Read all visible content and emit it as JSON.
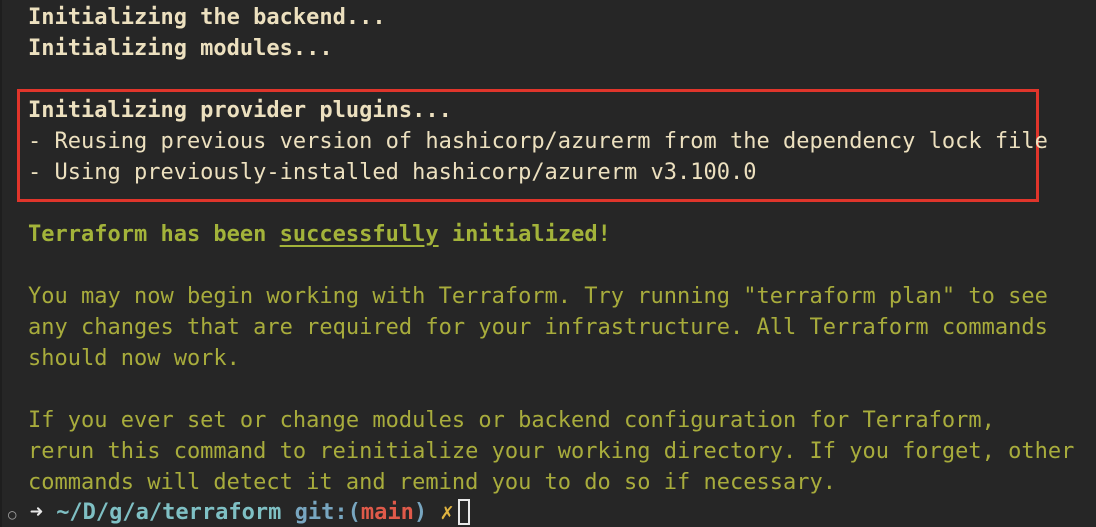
{
  "output": {
    "line1": "Initializing the backend...",
    "line2": "Initializing modules...",
    "provider_header": "Initializing provider plugins...",
    "provider_line1": "- Reusing previous version of hashicorp/azurerm from the dependency lock file",
    "provider_line2": "- Using previously-installed hashicorp/azurerm v3.100.0",
    "success_prefix": "Terraform has been ",
    "success_word": "successfully",
    "success_suffix": " initialized!",
    "info1_line1": "You may now begin working with Terraform. Try running \"terraform plan\" to see",
    "info1_line2": "any changes that are required for your infrastructure. All Terraform commands",
    "info1_line3": "should now work.",
    "info2_line1": "If you ever set or change modules or backend configuration for Terraform,",
    "info2_line2": "rerun this command to reinitialize your working directory. If you forget, other",
    "info2_line3": "commands will detect it and remind you to do so if necessary."
  },
  "prompt": {
    "indicator": "○",
    "arrow": "➜",
    "path": "~/D/g/a/terraform",
    "git_label": "git:",
    "paren_open": "(",
    "branch": "main",
    "paren_close": ")",
    "dirty_mark": "✗"
  },
  "colors": {
    "background": "#262626",
    "highlight_border": "#e0352b",
    "success_green": "#a3b33a",
    "info_olive": "#a8ac3c"
  }
}
